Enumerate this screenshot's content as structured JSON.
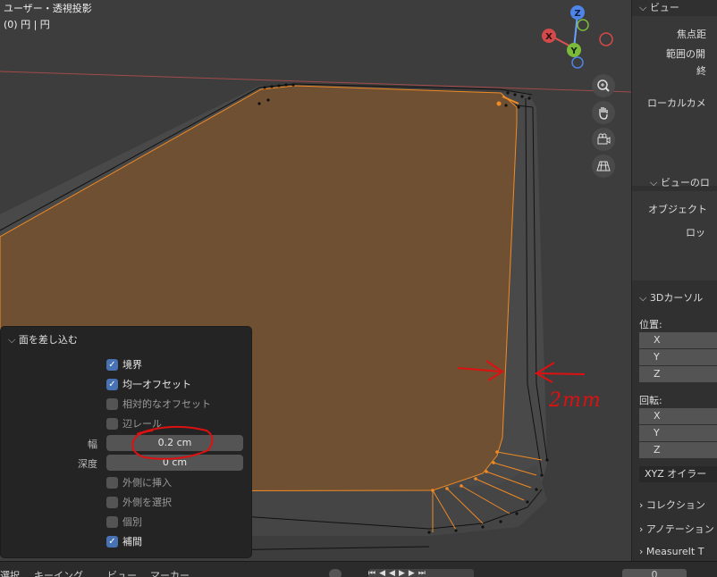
{
  "viewport": {
    "header_line1": "ユーザー・透視投影",
    "header_line2": "(0) 円 | 円",
    "annotation": "2mm",
    "gizmo": {
      "x": "X",
      "y": "Y",
      "z": "Z"
    }
  },
  "nav_buttons": [
    {
      "icon": "zoom-icon"
    },
    {
      "icon": "hand-pan-icon"
    },
    {
      "icon": "camera-icon"
    },
    {
      "icon": "grid-perspective-icon"
    }
  ],
  "op_panel": {
    "title": "面を差し込む",
    "checkboxes": [
      {
        "label": "境界",
        "checked": true
      },
      {
        "label": "均一オフセット",
        "checked": true
      },
      {
        "label": "相対的なオフセット",
        "checked": false
      },
      {
        "label": "辺レール",
        "checked": false
      }
    ],
    "width_label": "幅",
    "width_value": "0.2 cm",
    "depth_label": "深度",
    "depth_value": "0 cm",
    "checkboxes2": [
      {
        "label": "外側に挿入",
        "checked": false
      },
      {
        "label": "外側を選択",
        "checked": false
      },
      {
        "label": "個別",
        "checked": false
      },
      {
        "label": "補間",
        "checked": true
      }
    ]
  },
  "sidebar": {
    "view_header": "ビュー",
    "focal": "焦点距",
    "clip": "範囲の開",
    "end": "終",
    "local_camera": "ローカルカメ",
    "view_lock_header": "ビューのロ",
    "object": "オブジェクト",
    "lock": "ロッ",
    "cursor_header": "3Dカーソル",
    "location_label": "位置:",
    "loc_axes": [
      "X",
      "Y",
      "Z"
    ],
    "rotation_label": "回転:",
    "rot_axes": [
      "X",
      "Y",
      "Z"
    ],
    "rotation_mode": "XYZ オイラー",
    "collection": "コレクション",
    "annotation": "アノテーション",
    "measureit": "MeasureIt T"
  },
  "bottombar": {
    "item1": "選択",
    "item2": "キーイング",
    "item3": "ビュー",
    "item4": "マーカー",
    "frame": "0"
  }
}
